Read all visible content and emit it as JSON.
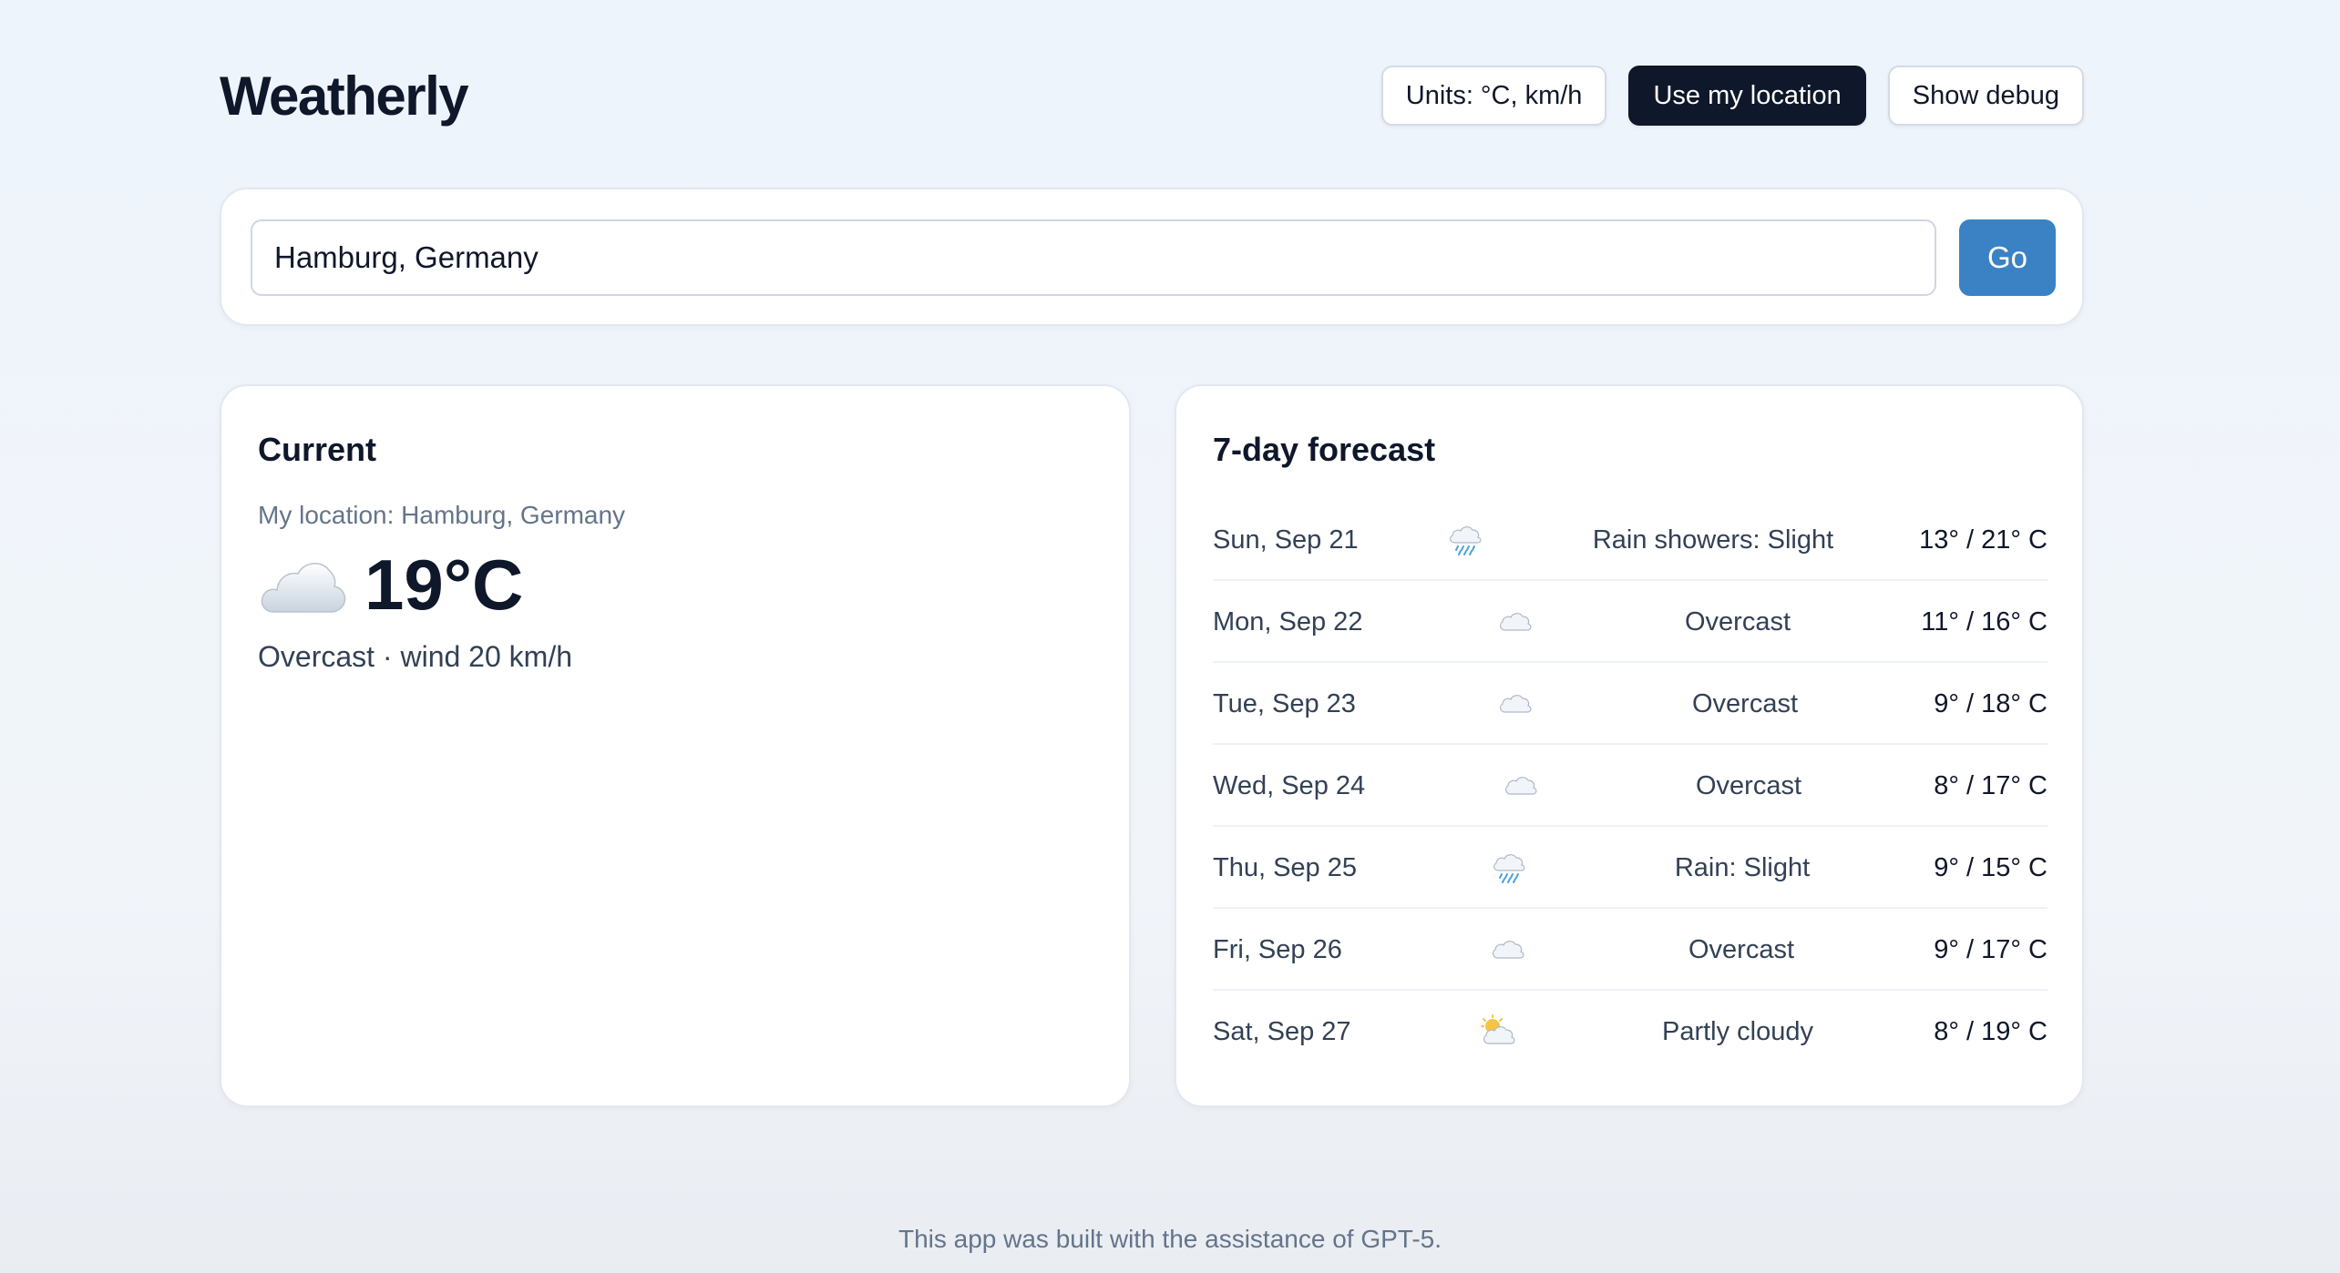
{
  "app": {
    "title": "Weatherly"
  },
  "header": {
    "units_label": "Units: °C, km/h",
    "location_label": "Use my location",
    "debug_label": "Show debug"
  },
  "search": {
    "value": "Hamburg, Germany",
    "go_label": "Go"
  },
  "current": {
    "title": "Current",
    "location": "My location: Hamburg, Germany",
    "icon": "cloud-icon",
    "temperature": "19°C",
    "summary": "Overcast · wind 20 km/h"
  },
  "forecast": {
    "title": "7-day forecast",
    "days": [
      {
        "day": "Sun, Sep 21",
        "icon": "rain-showers-icon",
        "condition": "Rain showers: Slight",
        "temps": "13° / 21° C"
      },
      {
        "day": "Mon, Sep 22",
        "icon": "cloud-icon",
        "condition": "Overcast",
        "temps": "11° / 16° C"
      },
      {
        "day": "Tue, Sep 23",
        "icon": "cloud-icon",
        "condition": "Overcast",
        "temps": "9° / 18° C"
      },
      {
        "day": "Wed, Sep 24",
        "icon": "cloud-icon",
        "condition": "Overcast",
        "temps": "8° / 17° C"
      },
      {
        "day": "Thu, Sep 25",
        "icon": "rain-icon",
        "condition": "Rain: Slight",
        "temps": "9° / 15° C"
      },
      {
        "day": "Fri, Sep 26",
        "icon": "cloud-icon",
        "condition": "Overcast",
        "temps": "9° / 17° C"
      },
      {
        "day": "Sat, Sep 27",
        "icon": "partly-cloudy-icon",
        "condition": "Partly cloudy",
        "temps": "8° / 19° C"
      }
    ]
  },
  "footer": {
    "text": "This app was built with the assistance of GPT-5."
  },
  "colors": {
    "background": "#eef4fb",
    "primary_dark": "#0f172a",
    "accent": "#3b82c4",
    "muted_text": "#64748b"
  }
}
